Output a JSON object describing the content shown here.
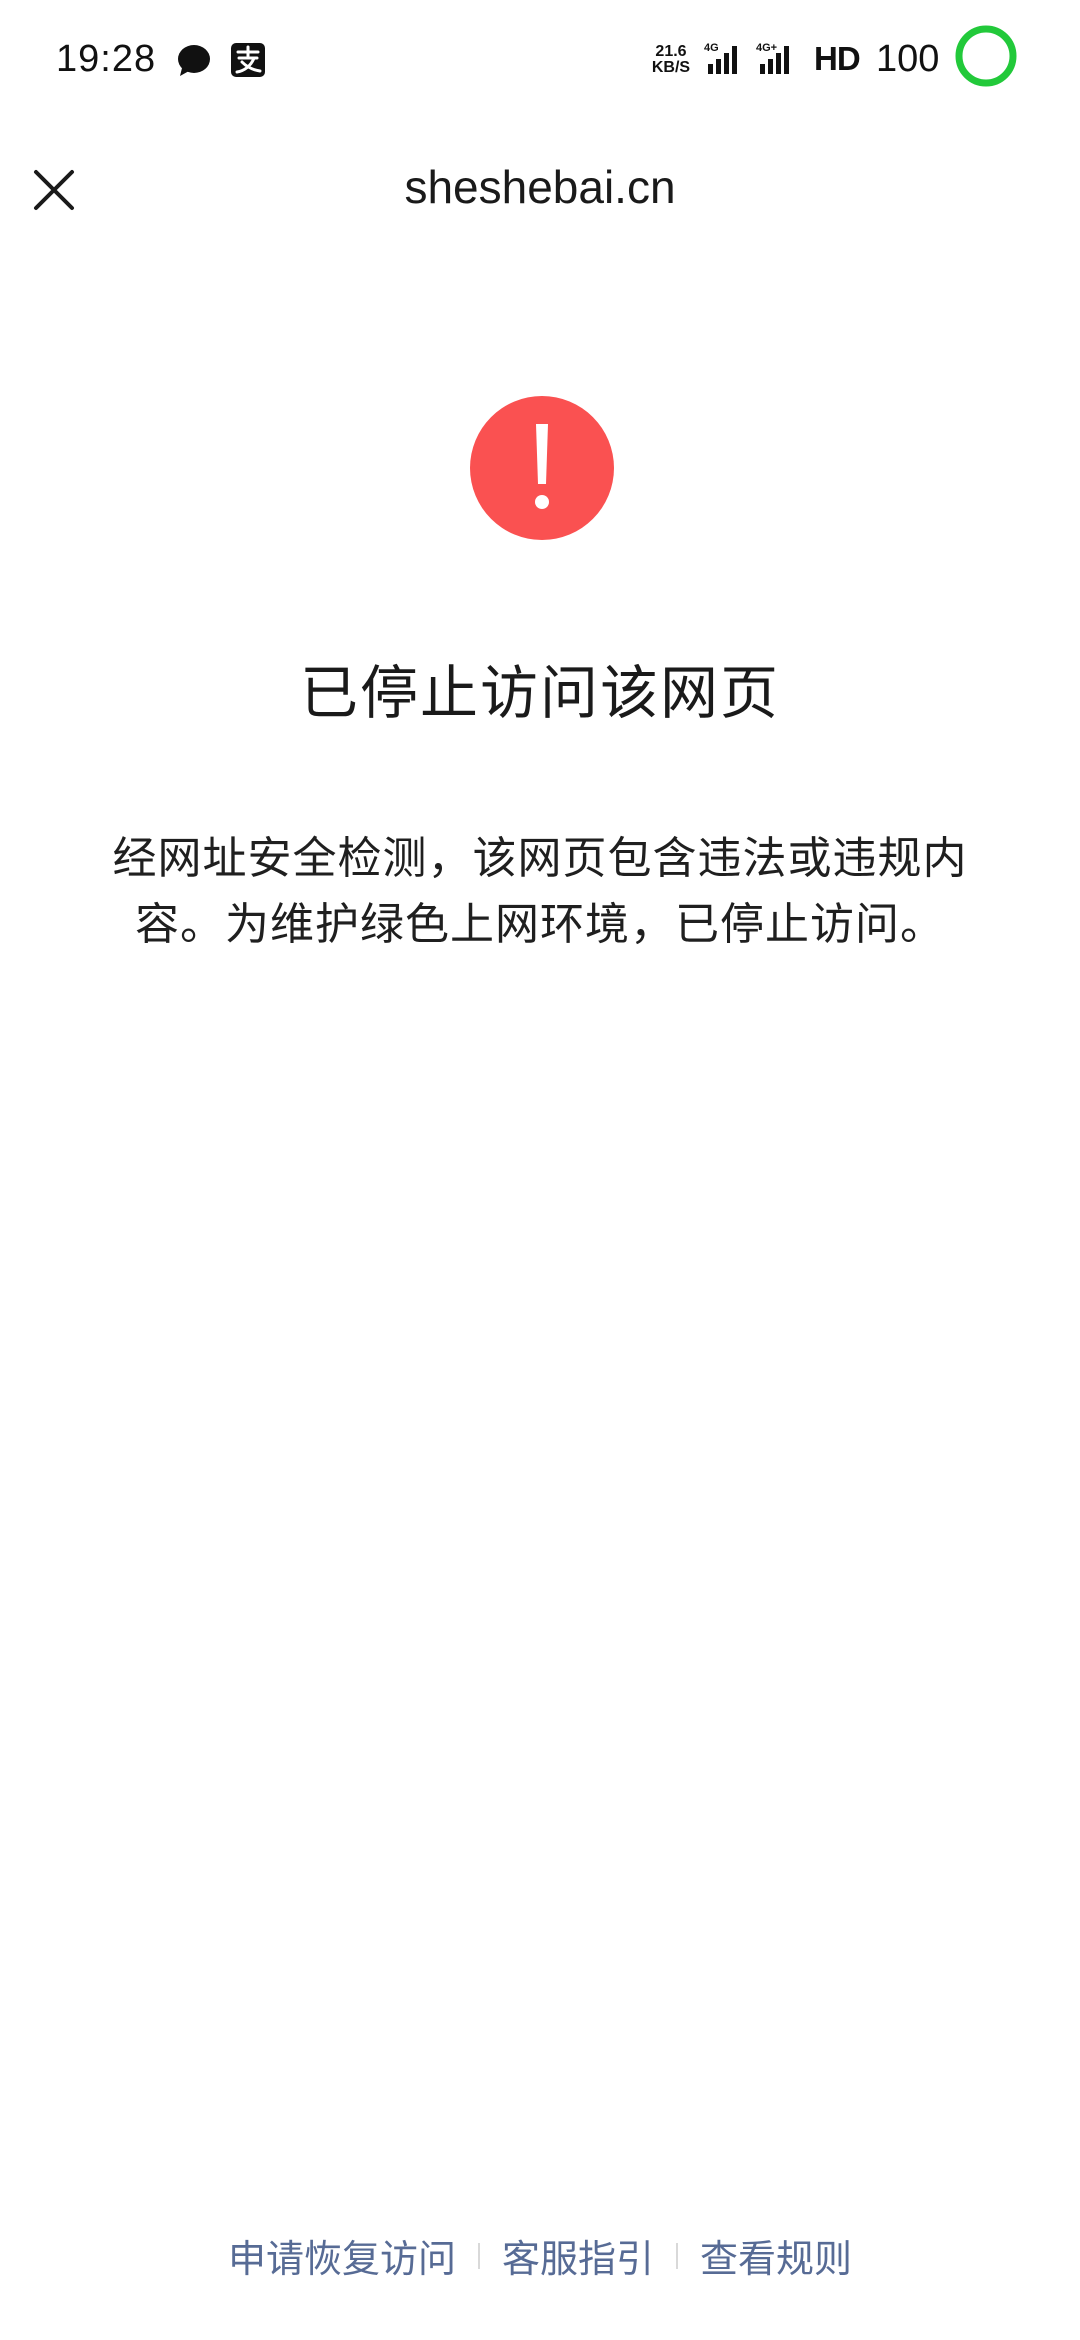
{
  "status_bar": {
    "time": "19:28",
    "icons": [
      "chat-bubble-icon",
      "alipay-icon"
    ],
    "net_speed_value": "21.6",
    "net_speed_unit": "KB/S",
    "signal_1_label": "4G",
    "signal_2_label": "4G+",
    "hd_label": "HD",
    "battery": "100",
    "battery_ring_color": "#22c93a"
  },
  "header": {
    "close_icon": "close-icon",
    "title": "sheshebai.cn"
  },
  "warning": {
    "icon": "exclamation-icon",
    "icon_color": "#fa5151",
    "heading": "已停止访问该网页",
    "description": "经网址安全检测，该网页包含违法或违规内容。为维护绿色上网环境，已停止访问。"
  },
  "footer": {
    "link_color": "#576b95",
    "links": [
      {
        "label": "申请恢复访问"
      },
      {
        "label": "客服指引"
      },
      {
        "label": "查看规则"
      }
    ]
  }
}
